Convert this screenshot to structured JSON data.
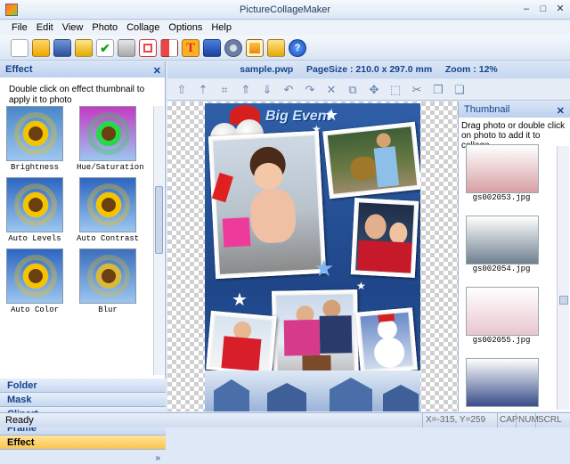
{
  "window": {
    "title": "PictureCollageMaker",
    "min": "–",
    "max": "□",
    "close": "✕"
  },
  "menu": [
    "File",
    "Edit",
    "View",
    "Photo",
    "Collage",
    "Options",
    "Help"
  ],
  "toolbar": [
    "new-icon",
    "open-icon",
    "save-icon",
    "notebook-icon",
    "check-icon",
    "print-icon",
    "layout-icon",
    "grid-icon",
    "text-icon",
    "monitor-icon",
    "settings-icon",
    "image-icon",
    "folder-icon",
    "help-icon"
  ],
  "effect_panel": {
    "title": "Effect",
    "close": "✕",
    "hint": "Double click on effect thumbnail to apply it to photo",
    "effects": [
      {
        "label": "Brightness",
        "petal": "#f4c400",
        "bg": "#4a87c8"
      },
      {
        "label": "Hue/Saturation",
        "petal": "#27d84a",
        "bg": "#c43ac4"
      },
      {
        "label": "Auto Levels",
        "petal": "#f4c400",
        "bg": "#2d66c0"
      },
      {
        "label": "Auto Contrast",
        "petal": "#f4c400",
        "bg": "#2d66c0"
      },
      {
        "label": "Auto Color",
        "petal": "#f4c400",
        "bg": "#2d66c0"
      },
      {
        "label": "Blur",
        "petal": "#d9b93a",
        "bg": "#3b6fba"
      }
    ],
    "nav": [
      "Folder",
      "Mask",
      "Clipart",
      "Frame",
      "Effect"
    ],
    "nav_active": "Effect",
    "more": "»"
  },
  "info": {
    "file": "sample.pwp",
    "pagesize_label": "PageSize :",
    "pagesize": "210.0 x 297.0 mm",
    "zoom_label": "Zoom :",
    "zoom": "12%"
  },
  "edit_tools": [
    "bring-front-icon",
    "bring-forward-icon",
    "crop-icon",
    "move-up-icon",
    "move-down-icon",
    "undo-icon",
    "redo-icon",
    "delete-icon",
    "duplicate-icon",
    "align-icon",
    "fit-icon",
    "cut-icon",
    "copy-icon",
    "paste-icon"
  ],
  "collage": {
    "title": "Big Event"
  },
  "thumbnail_panel": {
    "title": "Thumbnail",
    "close": "✕",
    "hint": "Drag photo or double click on photo to add it to collage",
    "items": [
      {
        "name": "gs002053.jpg",
        "color": "#d7a0a4"
      },
      {
        "name": "gs002054.jpg",
        "color": "#6f7f8f"
      },
      {
        "name": "gs002055.jpg",
        "color": "#e9c6cf"
      },
      {
        "name": "",
        "color": "#3a4d8a"
      }
    ]
  },
  "status": {
    "ready": "Ready",
    "coords": "X=-315, Y=259",
    "cap": "CAP",
    "num": "NUM",
    "scrl": "SCRL"
  }
}
